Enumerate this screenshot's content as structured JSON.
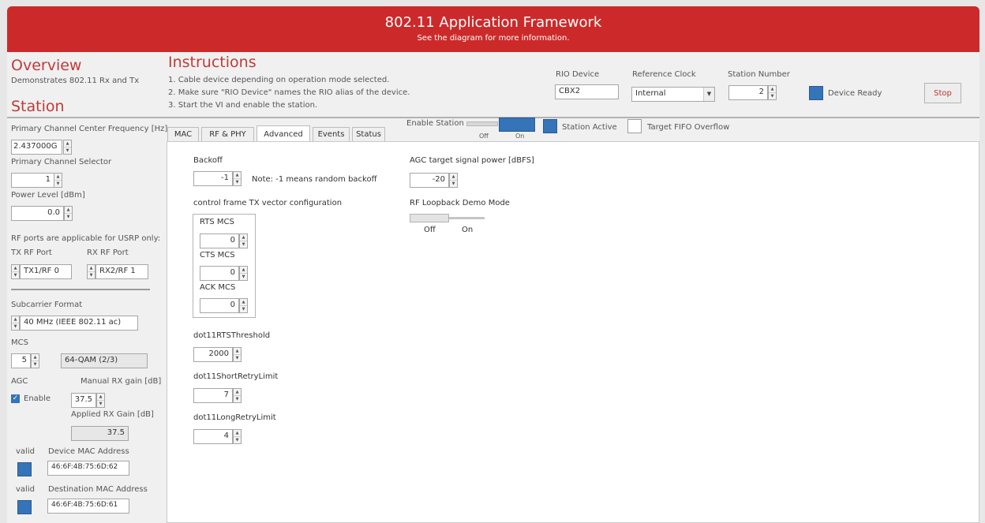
{
  "header": {
    "title": "802.11 Application Framework",
    "subtitle": "See the diagram for more information."
  },
  "overview": {
    "title": "Overview",
    "description": "Demonstrates 802.11 Rx and Tx"
  },
  "instructions": {
    "title": "Instructions",
    "steps": [
      "1. Cable device depending on operation mode selected.",
      "2. Make sure \"RIO Device\" names the RIO alias of the device.",
      "3. Start the VI and enable the station."
    ]
  },
  "top_controls": {
    "rio_device_label": "RIO Device",
    "rio_device_value": "CBX2",
    "reference_clock_label": "Reference Clock",
    "reference_clock_value": "Internal",
    "station_number_label": "Station Number",
    "station_number_value": "2",
    "device_ready_label": "Device Ready",
    "stop_label": "Stop"
  },
  "station": {
    "title": "Station",
    "primary_freq_label": "Primary Channel Center Frequency [Hz]",
    "primary_freq_value": "2.437000G",
    "primary_selector_label": "Primary Channel Selector",
    "primary_selector_value": "1",
    "power_level_label": "Power Level [dBm]",
    "power_level_value": "0.0",
    "rf_ports_note": "RF ports are applicable for USRP only:",
    "tx_rf_port_label": "TX RF Port",
    "tx_rf_port_value": "TX1/RF 0",
    "rx_rf_port_label": "RX RF Port",
    "rx_rf_port_value": "RX2/RF 1",
    "subcarrier_format_label": "Subcarrier Format",
    "subcarrier_format_value": "40 MHz (IEEE 802.11 ac)",
    "mcs_label": "MCS",
    "mcs_value": "5",
    "mcs_description": "64-QAM (2/3)",
    "agc_label": "AGC",
    "agc_enable_label": "Enable",
    "manual_rx_gain_label": "Manual RX gain [dB]",
    "manual_rx_gain_value": "37.5",
    "applied_rx_gain_label": "Applied RX Gain [dB]",
    "applied_rx_gain_value": "37.5",
    "valid_label_1": "valid",
    "device_mac_label": "Device MAC Address",
    "device_mac_value": "46:6F:4B:75:6D:62",
    "valid_label_2": "valid",
    "destination_mac_label": "Destination MAC Address",
    "destination_mac_value": "46:6F:4B:75:6D:61"
  },
  "enable_station": {
    "label": "Enable Station",
    "off_label": "Off",
    "on_label": "On",
    "station_active_label": "Station Active",
    "target_fifo_label": "Target FIFO Overflow"
  },
  "tabs": [
    {
      "label": "MAC"
    },
    {
      "label": "RF & PHY"
    },
    {
      "label": "Advanced"
    },
    {
      "label": "Events"
    },
    {
      "label": "Status"
    }
  ],
  "advanced": {
    "backoff_label": "Backoff",
    "backoff_value": "-1",
    "backoff_note": "Note: -1 means random backoff",
    "control_frame_label": "control frame TX vector configuration",
    "rts_mcs_label": "RTS MCS",
    "rts_mcs_value": "0",
    "cts_mcs_label": "CTS MCS",
    "cts_mcs_value": "0",
    "ack_mcs_label": "ACK MCS",
    "ack_mcs_value": "0",
    "rts_threshold_label": "dot11RTSThreshold",
    "rts_threshold_value": "2000",
    "short_retry_label": "dot11ShortRetryLimit",
    "short_retry_value": "7",
    "long_retry_label": "dot11LongRetryLimit",
    "long_retry_value": "4",
    "agc_target_label": "AGC target signal power [dBFS]",
    "agc_target_value": "-20",
    "rf_loopback_label": "RF Loopback Demo Mode",
    "rf_loopback_off": "Off",
    "rf_loopback_on": "On"
  },
  "colors": {
    "header_red": "#cc2a2a",
    "title_red": "#c13a3a",
    "led_blue": "#3574b8"
  }
}
